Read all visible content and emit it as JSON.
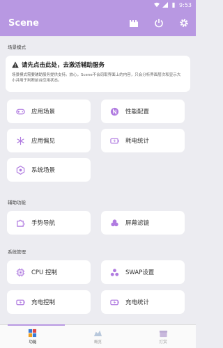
{
  "status": {
    "time": "9:53"
  },
  "app": {
    "title": "Scene"
  },
  "icons": {
    "toolbar": [
      "castle-icon",
      "power-icon",
      "gear-icon"
    ],
    "accent": "#b898e2",
    "icon_color": "#b07be0"
  },
  "sections": {
    "scene_mode": "场景模式",
    "assist": "辅助功能",
    "system": "系统管理"
  },
  "notice": {
    "title": "请先点击此处，去激活辅助服务",
    "body": "场景模式需要辅助服务提供支持。放心，Scene不会窃取界面上的内容，只会分析界面层次和显示大小并用于判断前台应用状态。"
  },
  "cards": {
    "app_scene": "应用场景",
    "perf_config": "性能配置",
    "app_pref": "应用偏见",
    "power_stats": "耗电统计",
    "system_scene": "系统场景",
    "gesture_nav": "手势导航",
    "screen_filter": "屏幕滤镜",
    "cpu_control": "CPU 控制",
    "swap_settings": "SWAP设置",
    "charge_control": "充电控制",
    "charge_stats": "充电统计"
  },
  "nav": {
    "tabs": [
      "功能",
      "概览",
      "打赏"
    ]
  }
}
